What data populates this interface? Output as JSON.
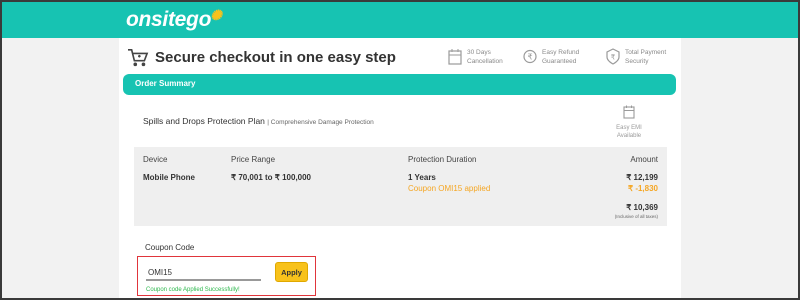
{
  "brand": {
    "logo_text": "onsitego",
    "logo_accent": "o",
    "color": "#17c3b2"
  },
  "header": {
    "title": "Secure checkout in one easy step",
    "features": [
      {
        "icon": "calendar-icon",
        "line1": "30 Days",
        "line2": "Cancellation"
      },
      {
        "icon": "rupee-refund-icon",
        "line1": "Easy Refund",
        "line2": "Guaranteed"
      },
      {
        "icon": "rupee-secure-icon",
        "line1": "Total Payment",
        "line2": "Security"
      }
    ]
  },
  "summary": {
    "bar_label": "Order Summary",
    "plan_name": "Spills and Drops Protection Plan",
    "plan_sub": "| Comprehensive Damage Protection",
    "emi_line1": "Easy EMI",
    "emi_line2": "Available"
  },
  "table": {
    "headers": {
      "device": "Device",
      "price_range": "Price Range",
      "duration": "Protection Duration",
      "amount": "Amount"
    },
    "row": {
      "device": "Mobile Phone",
      "price_range": "₹ 70,001 to ₹ 100,000",
      "duration": "1 Years",
      "coupon_applied": "Coupon OMI15 applied",
      "amount": "₹ 12,199",
      "discount": "₹ -1,830",
      "total": "₹ 10,369",
      "tax_note": "(Inclusive of all taxes)"
    }
  },
  "coupon": {
    "label": "Coupon Code",
    "value": "OMI15",
    "apply_label": "Apply",
    "success": "Coupon code Applied Successfully!"
  },
  "colors": {
    "accent": "#17c3b2",
    "button": "#f8c21b",
    "discount": "#f5a623",
    "success": "#2db84d",
    "highlight_box": "#e0353b"
  }
}
